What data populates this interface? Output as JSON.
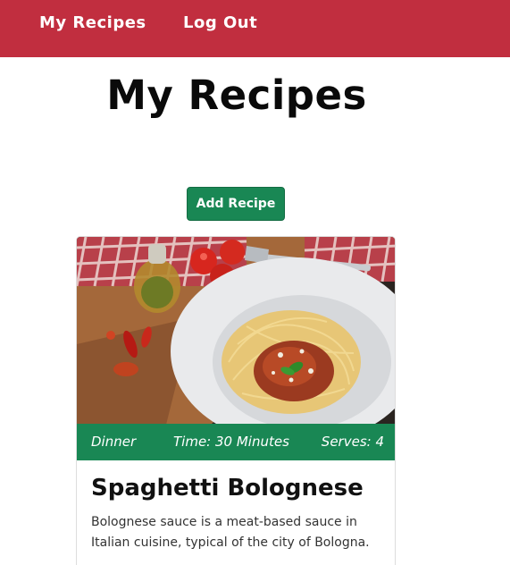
{
  "nav": {
    "my_recipes": "My Recipes",
    "log_out": "Log Out"
  },
  "page": {
    "title": "My Recipes"
  },
  "actions": {
    "add_recipe": "Add Recipe"
  },
  "recipes": [
    {
      "category": "Dinner",
      "time": "Time: 30 Minutes",
      "serves": "Serves: 4",
      "title": "Spaghetti Bolognese",
      "description": "Bolognese sauce is a meat-based sauce in Italian cuisine, typical of the city of Bologna.",
      "image_icon": "spaghetti-plate-photo"
    }
  ],
  "colors": {
    "navbar": "#c12e3f",
    "accent_green": "#198754"
  }
}
